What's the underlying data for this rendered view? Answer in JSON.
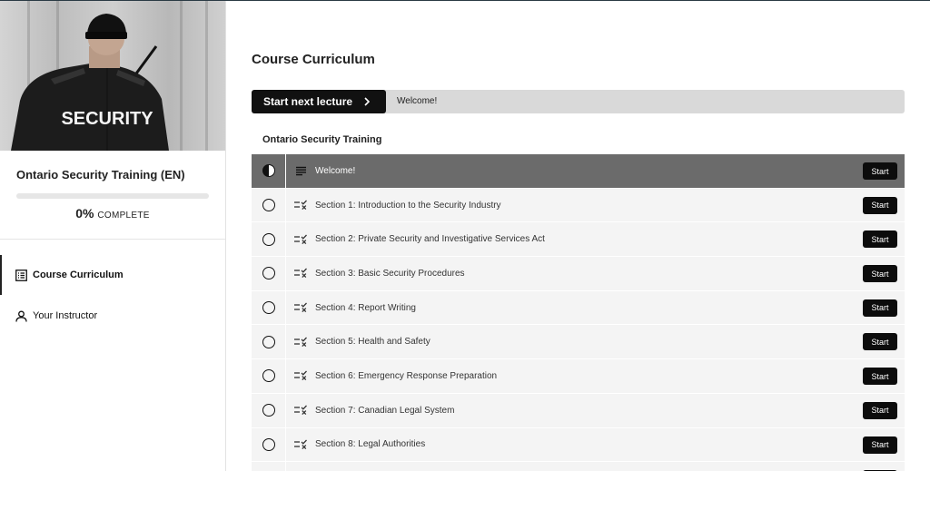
{
  "sidebar": {
    "course_name": "Ontario Security Training (EN)",
    "progress": {
      "percent_value": 0,
      "percent_label": "0%",
      "word": "COMPLETE"
    },
    "hero_text": "SECURITY",
    "nav": [
      {
        "label": "Course Curriculum",
        "icon": "curriculum-list-icon",
        "active": true
      },
      {
        "label": "Your Instructor",
        "icon": "person-icon",
        "active": false
      }
    ]
  },
  "main": {
    "title": "Course Curriculum",
    "next_button_label": "Start next lecture",
    "next_lecture_name": "Welcome!",
    "section_title": "Ontario Security Training",
    "lectures": [
      {
        "title": "Welcome!",
        "type": "text-lines-icon",
        "button": "Start",
        "active": true
      },
      {
        "title": "Section 1: Introduction to the Security Industry",
        "type": "quiz-icon",
        "button": "Start"
      },
      {
        "title": "Section 2: Private Security and Investigative Services Act",
        "type": "quiz-icon",
        "button": "Start"
      },
      {
        "title": "Section 3: Basic Security Procedures",
        "type": "quiz-icon",
        "button": "Start"
      },
      {
        "title": "Section 4: Report Writing",
        "type": "quiz-icon",
        "button": "Start"
      },
      {
        "title": "Section 5: Health and Safety",
        "type": "quiz-icon",
        "button": "Start"
      },
      {
        "title": "Section 6: Emergency Response Preparation",
        "type": "quiz-icon",
        "button": "Start"
      },
      {
        "title": "Section 7: Canadian Legal System",
        "type": "quiz-icon",
        "button": "Start"
      },
      {
        "title": "Section 8: Legal Authorities",
        "type": "quiz-icon",
        "button": "Start"
      }
    ]
  },
  "colors": {
    "accent": "#111111",
    "active_row": "#6b6b6b",
    "row_bg": "#f4f4f4",
    "next_bar": "#d9d9d9"
  }
}
